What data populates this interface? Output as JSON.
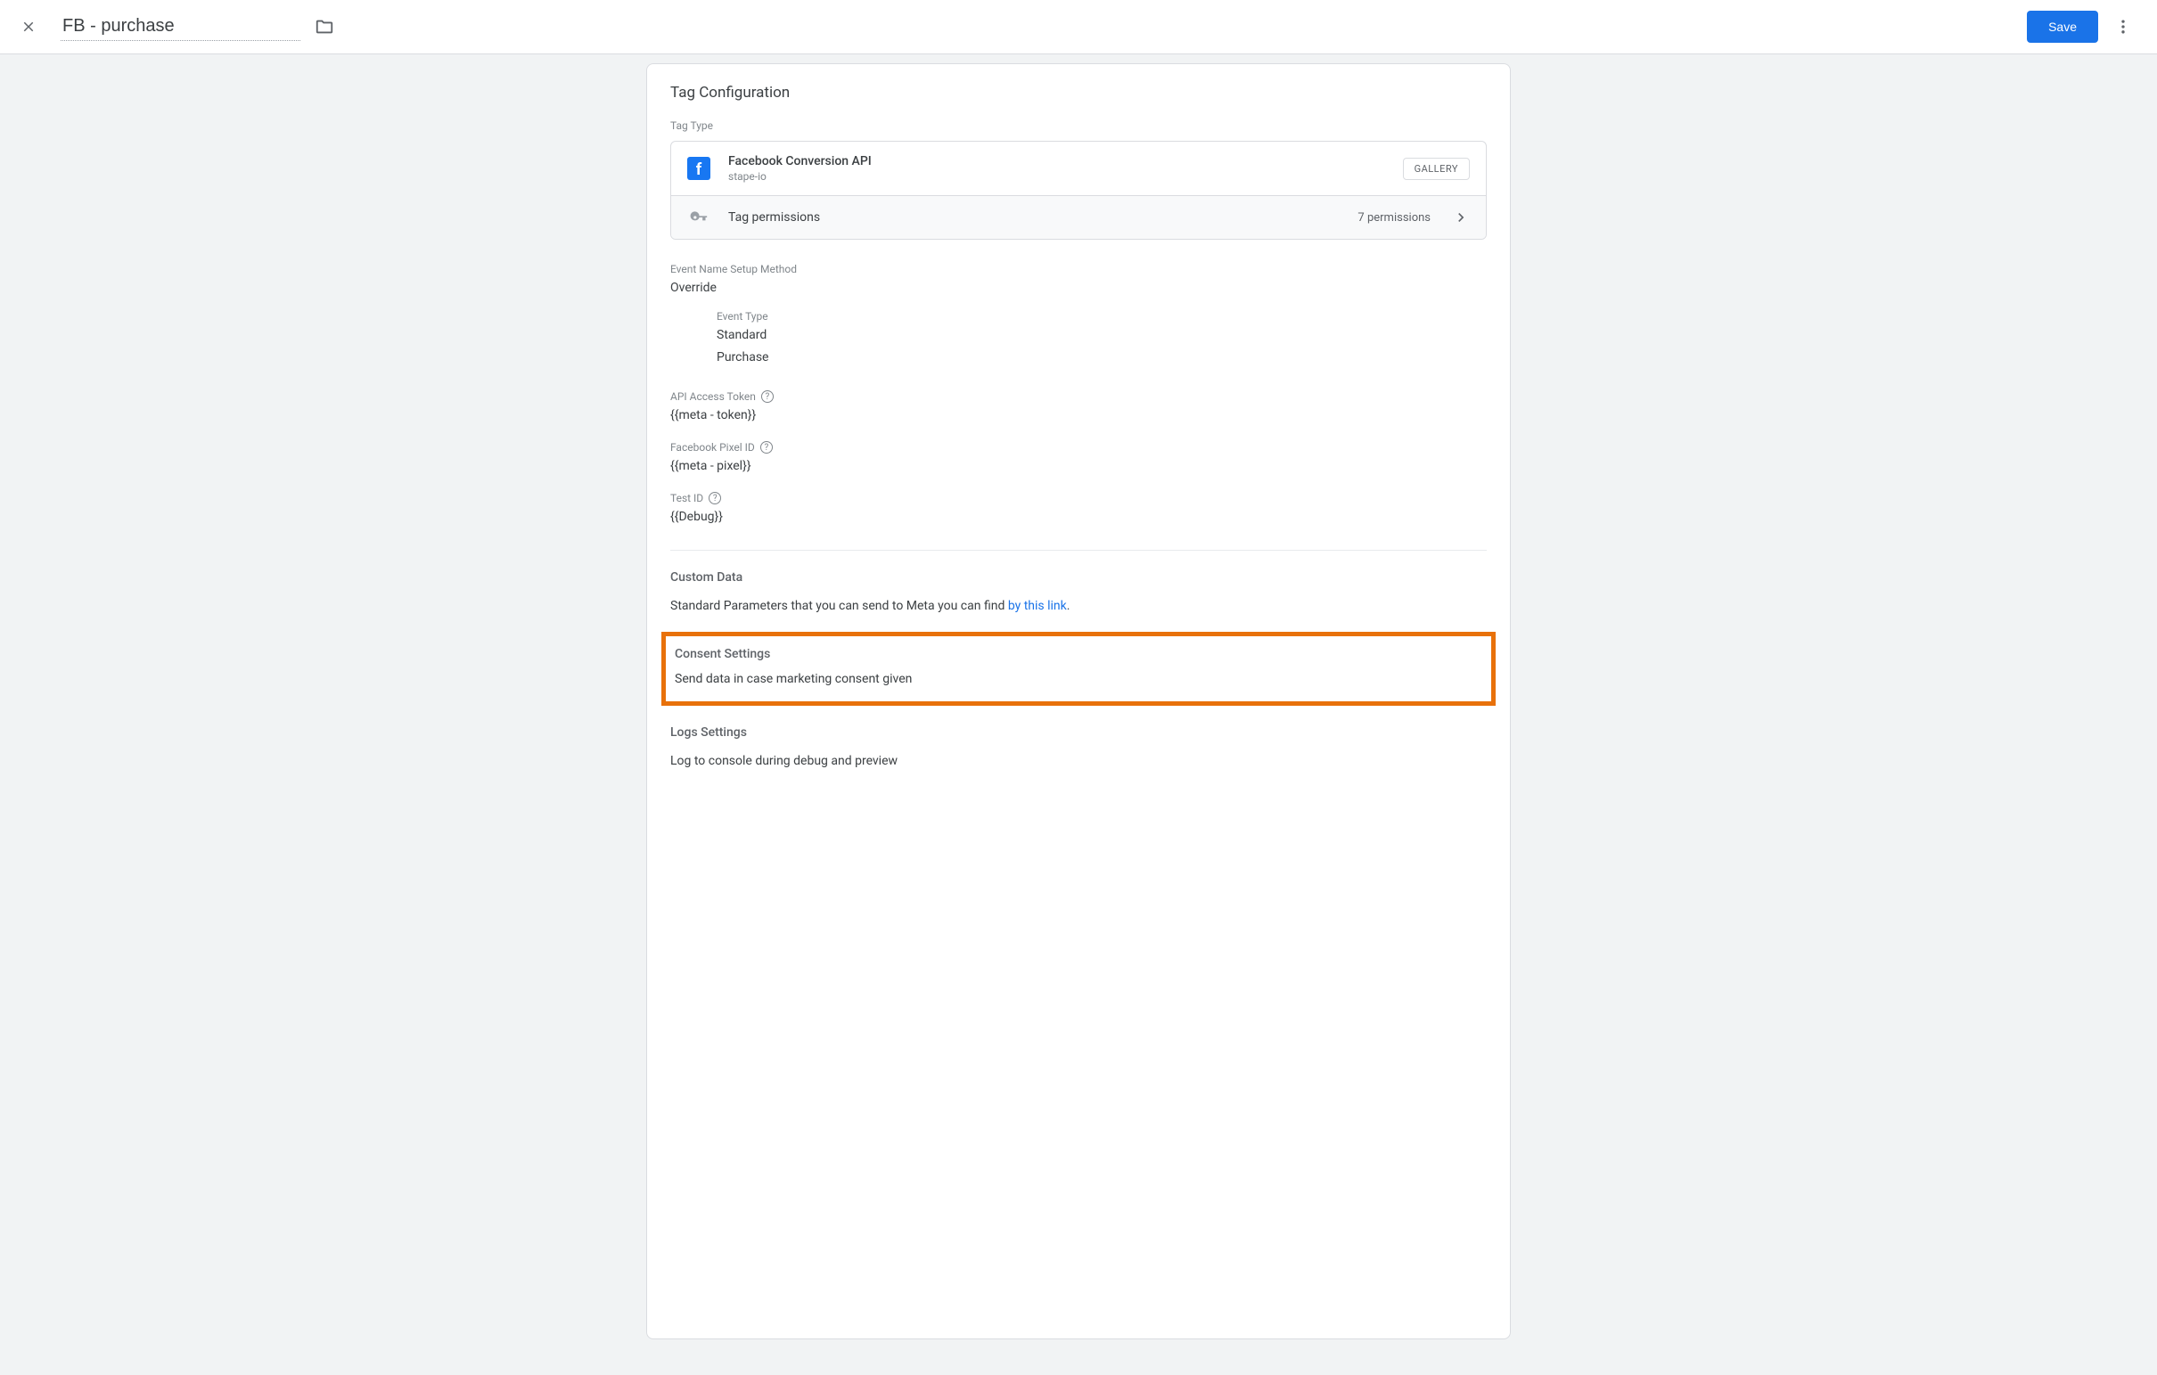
{
  "header": {
    "title": "FB - purchase",
    "save_label": "Save"
  },
  "card": {
    "title": "Tag Configuration",
    "tag_type_label": "Tag Type",
    "tag_type": {
      "name": "Facebook Conversion API",
      "provider": "stape-io",
      "gallery_badge": "GALLERY"
    },
    "permissions": {
      "label": "Tag permissions",
      "count": "7 permissions"
    },
    "event_method": {
      "label": "Event Name Setup Method",
      "value": "Override",
      "event_type_label": "Event Type",
      "event_type_value": "Standard",
      "event_name_value": "Purchase"
    },
    "api_token": {
      "label": "API Access Token",
      "value": "{{meta - token}}"
    },
    "pixel_id": {
      "label": "Facebook Pixel ID",
      "value": "{{meta - pixel}}"
    },
    "test_id": {
      "label": "Test ID",
      "value": "{{Debug}}"
    },
    "custom_data": {
      "heading": "Custom Data",
      "text_prefix": "Standard Parameters that you can send to Meta you can find ",
      "link_text": "by this link",
      "text_suffix": "."
    },
    "consent": {
      "heading": "Consent Settings",
      "text": "Send data in case marketing consent given"
    },
    "logs": {
      "heading": "Logs Settings",
      "text": "Log to console during debug and preview"
    }
  }
}
